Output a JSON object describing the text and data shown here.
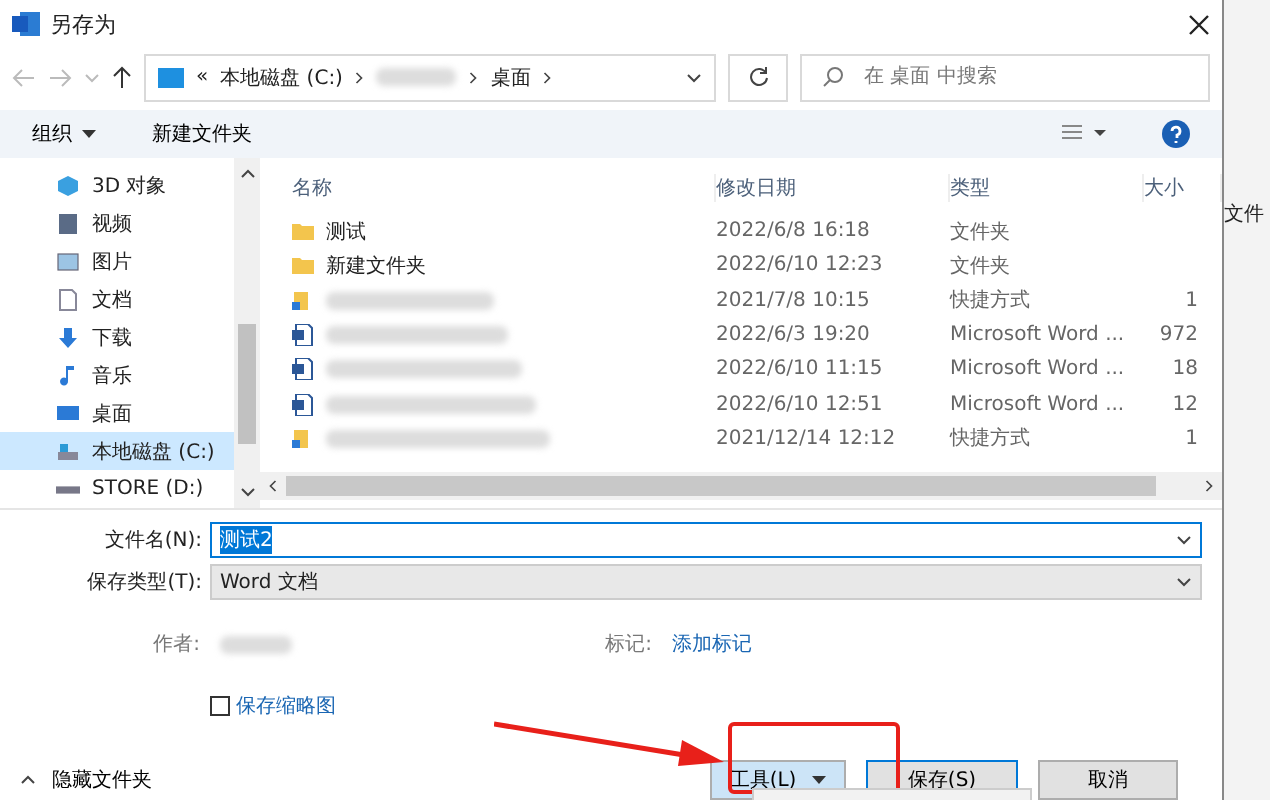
{
  "window": {
    "title": "另存为"
  },
  "address": {
    "crumbs": [
      {
        "kind": "text",
        "text": "«"
      },
      {
        "kind": "text",
        "text": "本地磁盘 (C:)"
      },
      {
        "kind": "hidden"
      },
      {
        "kind": "text",
        "text": "桌面"
      }
    ],
    "search_placeholder": "在 桌面 中搜索"
  },
  "toolbar": {
    "organize": "组织",
    "new_folder": "新建文件夹"
  },
  "sidebar": {
    "items": [
      {
        "kind": "cube",
        "label": "3D 对象",
        "selected": false
      },
      {
        "kind": "film",
        "label": "视频",
        "selected": false
      },
      {
        "kind": "image",
        "label": "图片",
        "selected": false
      },
      {
        "kind": "doc",
        "label": "文档",
        "selected": false
      },
      {
        "kind": "download",
        "label": "下载",
        "selected": false
      },
      {
        "kind": "music",
        "label": "音乐",
        "selected": false
      },
      {
        "kind": "desktop",
        "label": "桌面",
        "selected": false
      },
      {
        "kind": "drive",
        "label": "本地磁盘 (C:)",
        "selected": true
      },
      {
        "kind": "disk",
        "label": "STORE (D:)",
        "selected": false
      }
    ]
  },
  "files": {
    "columns": [
      "名称",
      "修改日期",
      "类型",
      "大小"
    ],
    "rows": [
      {
        "kind": "folder",
        "name": "测试",
        "date": "2022/6/8 16:18",
        "type": "文件夹"
      },
      {
        "kind": "folder",
        "name": "新建文件夹",
        "date": "2022/6/10 12:23",
        "type": "文件夹"
      },
      {
        "kind": "shortcut",
        "date": "2021/7/8 10:15",
        "type": "快捷方式",
        "size": "1"
      },
      {
        "kind": "word",
        "date": "2022/6/3 19:20",
        "type": "Microsoft Word ...",
        "size": "972"
      },
      {
        "kind": "word",
        "date": "2022/6/10 11:15",
        "type": "Microsoft Word ...",
        "size": "18"
      },
      {
        "kind": "word",
        "date": "2022/6/10 12:51",
        "type": "Microsoft Word ...",
        "size": "12"
      },
      {
        "kind": "shortcut",
        "date": "2021/12/14 12:12",
        "type": "快捷方式",
        "size": "1"
      }
    ]
  },
  "form": {
    "filename_label": "文件名(N):",
    "filename": "测试2",
    "type_label": "保存类型(T):",
    "type": "Word 文档",
    "author_label": "作者:",
    "tags_label": "标记:",
    "tags_link": "添加标记",
    "thumbnail": {
      "label": "保存缩略图",
      "checked": false
    }
  },
  "footer": {
    "hide_folders": "隐藏文件夹",
    "tools": "工具(L)",
    "save": "保存(S)",
    "cancel": "取消"
  },
  "background": {
    "text": "文件"
  }
}
